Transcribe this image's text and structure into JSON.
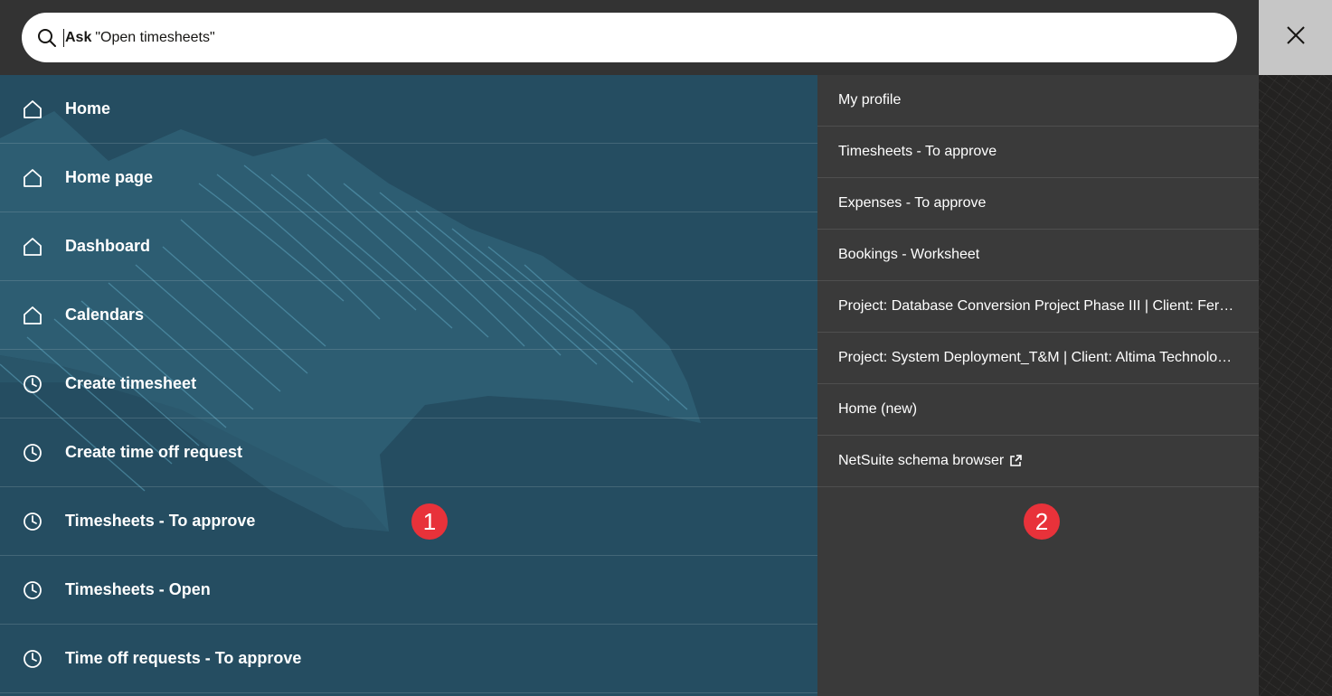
{
  "search": {
    "bold_prefix": "Ask",
    "hint": "\"Open timesheets\""
  },
  "icons": {
    "search": "search-icon",
    "close": "close-icon",
    "home": "home-icon",
    "clock": "clock-icon",
    "external": "external-link-icon"
  },
  "colors": {
    "left_panel": "#254d61",
    "recent_panel": "#3a3a3a",
    "badge": "#e8323a"
  },
  "nav": {
    "items": [
      {
        "label": "Home",
        "icon": "home-icon"
      },
      {
        "label": "Home page",
        "icon": "home-icon"
      },
      {
        "label": "Dashboard",
        "icon": "home-icon"
      },
      {
        "label": "Calendars",
        "icon": "home-icon"
      },
      {
        "label": "Create timesheet",
        "icon": "clock-icon"
      },
      {
        "label": "Create time off request",
        "icon": "clock-icon"
      },
      {
        "label": "Timesheets - To approve",
        "icon": "clock-icon"
      },
      {
        "label": "Timesheets - Open",
        "icon": "clock-icon"
      },
      {
        "label": "Time off requests - To approve",
        "icon": "clock-icon"
      }
    ]
  },
  "recent": {
    "items": [
      {
        "label": "My profile"
      },
      {
        "label": "Timesheets - To approve"
      },
      {
        "label": "Expenses - To approve"
      },
      {
        "label": "Bookings - Worksheet"
      },
      {
        "label": "Project: Database Conversion Project Phase III | Client: Fern Technologies"
      },
      {
        "label": "Project: System Deployment_T&M | Client: Altima Technologies"
      },
      {
        "label": "Home (new)"
      },
      {
        "label": "NetSuite schema browser"
      }
    ]
  },
  "badges": {
    "one": "1",
    "two": "2"
  }
}
